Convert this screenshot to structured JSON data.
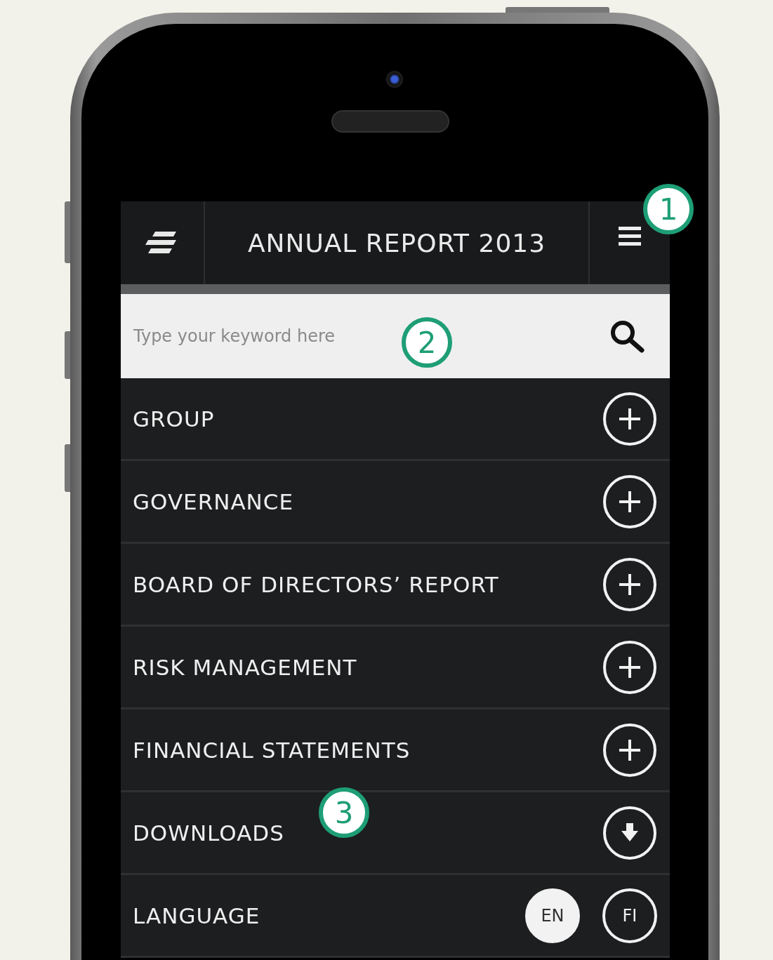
{
  "header": {
    "title": "ANNUAL REPORT 2013"
  },
  "search": {
    "placeholder": "Type your keyword here"
  },
  "menu": [
    {
      "label": "GROUP",
      "kind": "expand"
    },
    {
      "label": "GOVERNANCE",
      "kind": "expand"
    },
    {
      "label": "BOARD OF DIRECTORS’ REPORT",
      "kind": "expand"
    },
    {
      "label": "RISK MANAGEMENT",
      "kind": "expand"
    },
    {
      "label": "FINANCIAL STATEMENTS",
      "kind": "expand"
    },
    {
      "label": "DOWNLOADS",
      "kind": "download"
    },
    {
      "label": "LANGUAGE",
      "kind": "language",
      "options": [
        {
          "label": "EN",
          "selected": true
        },
        {
          "label": "FI",
          "selected": false
        }
      ]
    }
  ],
  "callouts": [
    "1",
    "2",
    "3"
  ]
}
